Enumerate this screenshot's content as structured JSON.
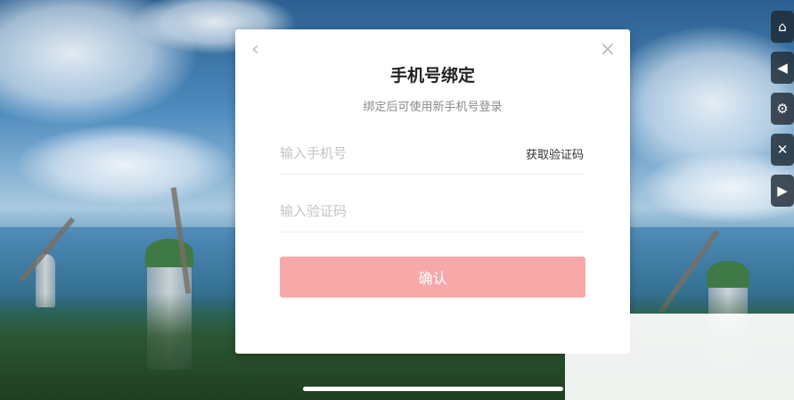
{
  "dialog": {
    "title": "手机号绑定",
    "subtitle": "绑定后可使用新手机号登录",
    "back_icon": "chevron-left-icon",
    "close_icon": "close-icon",
    "phone_placeholder": "输入手机号",
    "code_placeholder": "输入验证码",
    "get_code_label": "获取验证码",
    "confirm_label": "确认"
  },
  "colors": {
    "confirm_button": "#f7a9aa",
    "overlay_white": "#ffffff"
  },
  "side_icons": [
    "home-icon",
    "speaker-icon",
    "settings-icon",
    "tools-icon",
    "video-icon"
  ]
}
